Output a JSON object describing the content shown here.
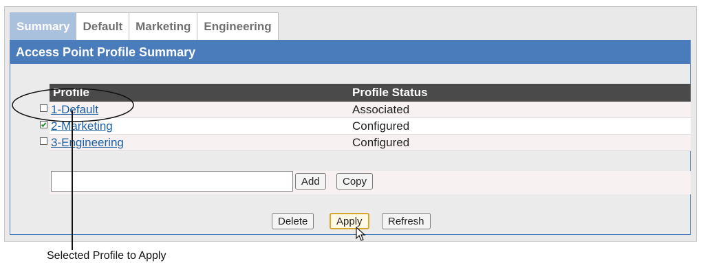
{
  "tabs": [
    "Summary",
    "Default",
    "Marketing",
    "Engineering"
  ],
  "panel": {
    "title": "Access Point Profile Summary"
  },
  "table": {
    "headers": [
      "Profile",
      "Profile Status"
    ],
    "rows": [
      {
        "profile": "1-Default",
        "status": "Associated",
        "checked": false
      },
      {
        "profile": "2-Marketing",
        "status": "Configured",
        "checked": true
      },
      {
        "profile": "3-Engineering",
        "status": "Configured",
        "checked": false
      }
    ]
  },
  "add": {
    "value": "",
    "add_label": "Add",
    "copy_label": "Copy"
  },
  "actions": {
    "delete_label": "Delete",
    "apply_label": "Apply",
    "refresh_label": "Refresh"
  },
  "annotation": {
    "label": "Selected Profile to Apply"
  },
  "icons": [
    "checkbox-icon",
    "checkmark-icon",
    "mouse-cursor-icon"
  ]
}
